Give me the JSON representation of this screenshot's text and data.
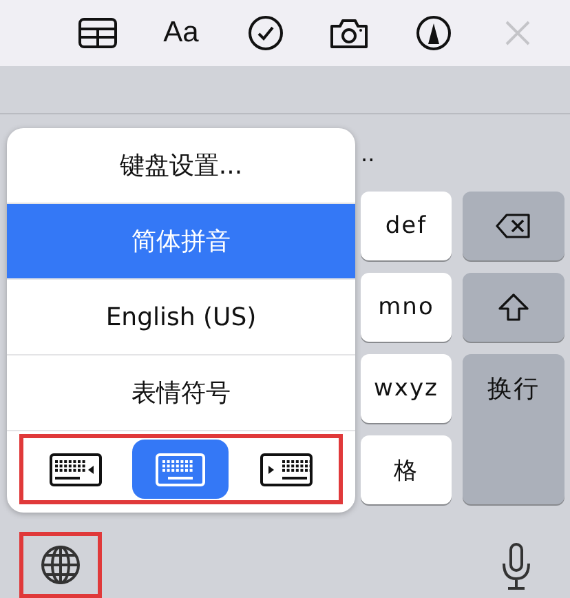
{
  "toolbar": {
    "format_label": "Aa",
    "close_disabled": true
  },
  "suggestion": "..",
  "keys": [
    {
      "kind": "letter",
      "label": "def"
    },
    {
      "kind": "delete"
    },
    {
      "kind": "letter",
      "label": "mno"
    },
    {
      "kind": "shift"
    },
    {
      "kind": "letter",
      "label": "wxyz"
    },
    {
      "kind": "return",
      "label": "换行"
    },
    {
      "kind": "letter",
      "label": "格"
    }
  ],
  "menu": {
    "items": [
      {
        "label": "键盘设置...",
        "selected": false
      },
      {
        "label": "简体拼音",
        "selected": true
      },
      {
        "label": "English (US)",
        "selected": false
      },
      {
        "label": "表情符号",
        "selected": false
      }
    ],
    "layouts": [
      {
        "kind": "left",
        "selected": false
      },
      {
        "kind": "center",
        "selected": true
      },
      {
        "kind": "right",
        "selected": false
      }
    ]
  }
}
